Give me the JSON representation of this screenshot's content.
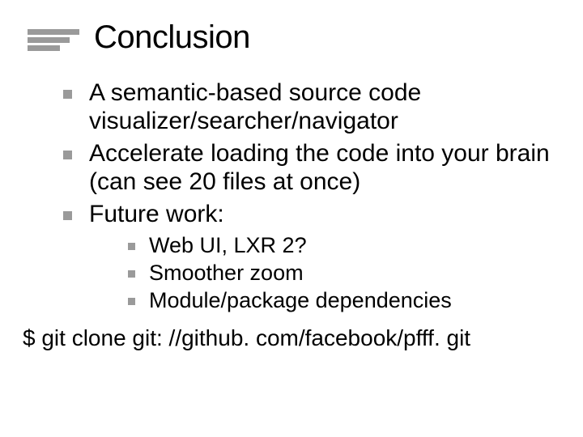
{
  "title": "Conclusion",
  "bullets": {
    "b1": "A semantic-based source code visualizer/searcher/navigator",
    "b2": "Accelerate loading the code into your brain (can see 20 files at once)",
    "b3": "Future work:",
    "sub": {
      "s1": "Web UI, LXR 2?",
      "s2": "Smoother zoom",
      "s3": "Module/package dependencies"
    }
  },
  "footer": "$ git clone git: //github. com/facebook/pfff. git"
}
